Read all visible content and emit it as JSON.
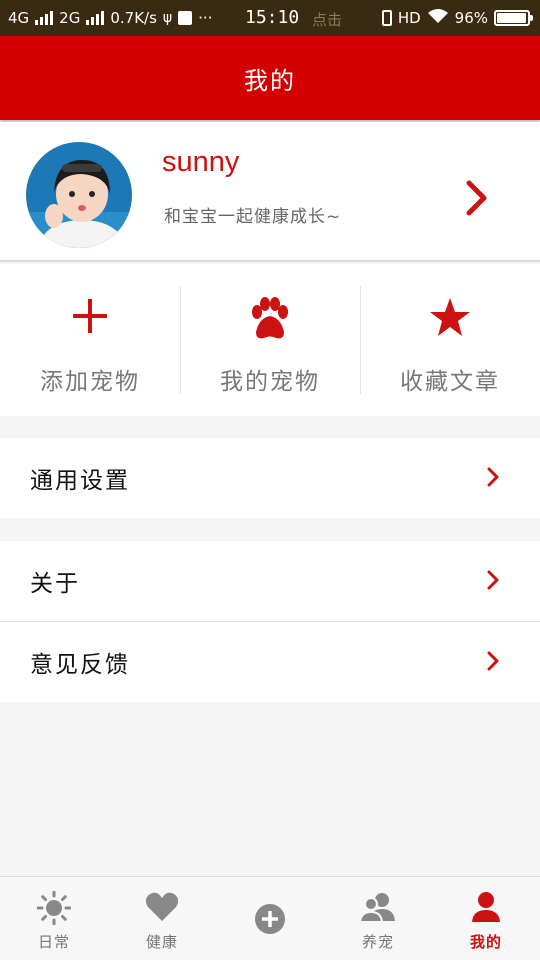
{
  "status_bar": {
    "network1": "4G",
    "network2": "2G",
    "speed": "0.7K/s",
    "time": "15:10",
    "notification_text": "点击",
    "hd": "HD",
    "battery": "96%",
    "battery_level": 0.96
  },
  "header": {
    "title": "我的"
  },
  "profile": {
    "username": "sunny",
    "motto": "和宝宝一起健康成长~"
  },
  "quick_actions": [
    {
      "label": "添加宠物",
      "icon": "plus-icon"
    },
    {
      "label": "我的宠物",
      "icon": "paw-icon"
    },
    {
      "label": "收藏文章",
      "icon": "star-icon"
    }
  ],
  "settings": {
    "general": "通用设置",
    "about": "关于",
    "feedback": "意见反馈"
  },
  "tabbar": {
    "items": [
      {
        "label": "日常",
        "icon": "sun-icon"
      },
      {
        "label": "健康",
        "icon": "heart-icon"
      },
      {
        "label": "",
        "icon": "add-circle-icon"
      },
      {
        "label": "养宠",
        "icon": "users-icon"
      },
      {
        "label": "我的",
        "icon": "person-icon"
      }
    ],
    "active_index": 4
  },
  "colors": {
    "brand": "#d20000",
    "accent_text": "#cc1111",
    "inactive": "#888888"
  }
}
